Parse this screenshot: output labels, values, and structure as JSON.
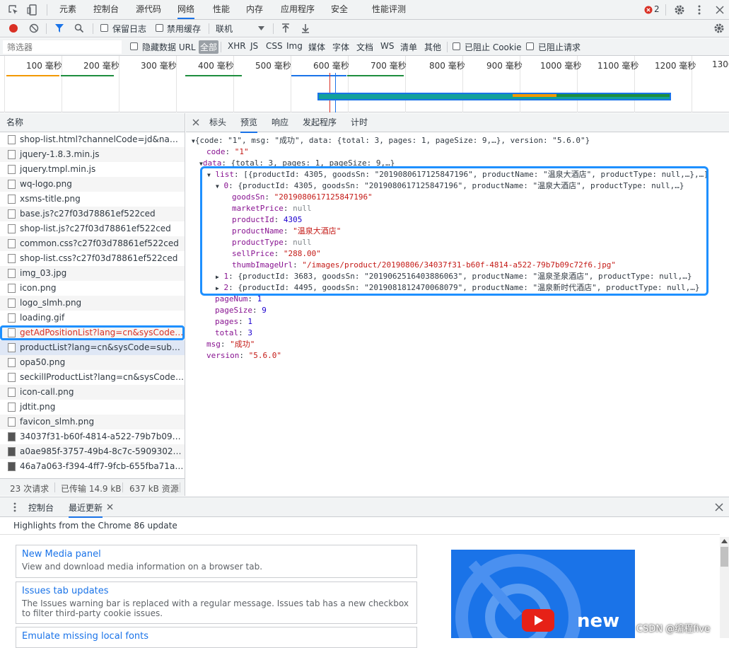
{
  "top_tabs": [
    "元素",
    "控制台",
    "源代码",
    "网络",
    "性能",
    "内存",
    "应用程序",
    "安全",
    "性能评测"
  ],
  "active_tab": "网络",
  "error_count": "2",
  "toolbar": {
    "preserve_log": "保留日志",
    "disable_cache": "禁用缓存",
    "throttle": "联机"
  },
  "filter": {
    "placeholder": "筛选器",
    "hide_data_url": "隐藏数据 URL",
    "types": [
      "全部",
      "XHR",
      "JS",
      "CSS",
      "Img",
      "媒体",
      "字体",
      "文档",
      "WS",
      "清单",
      "其他"
    ],
    "blocked_cookie": "已阻止 Cookie",
    "blocked_requests": "已阻止请求"
  },
  "timeline": {
    "ticks": [
      "100 毫秒",
      "200 毫秒",
      "300 毫秒",
      "400 毫秒",
      "500 毫秒",
      "600 毫秒",
      "700 毫秒",
      "800 毫秒",
      "900 毫秒",
      "1000 毫秒",
      "1100 毫秒",
      "1200 毫秒",
      "1300"
    ]
  },
  "requests": {
    "header": "名称",
    "items": [
      "shop-list.html?channelCode=jd&name=...",
      "jquery-1.8.3.min.js",
      "jquery.tmpl.min.js",
      "wq-logo.png",
      "xsms-title.png",
      "base.js?c27f03d78861ef522ced",
      "shop-list.js?c27f03d78861ef522ced",
      "common.css?c27f03d78861ef522ced",
      "shop-list.css?c27f03d78861ef522ced",
      "img_03.jpg",
      "icon.png",
      "logo_slmh.png",
      "loading.gif",
      "getAdPositionList?lang=cn&sysCode=su...",
      "productList?lang=cn&sysCode=sub7415...",
      "opa50.png",
      "seckillProductList?lang=cn&sysCode=sub...",
      "icon-call.png",
      "jdtit.png",
      "favicon_slmh.png",
      "34037f31-b60f-4814-a522-79b7b09c72f6...",
      "a0ae985f-3757-49b4-8c7c-590930265b0...",
      "46a7a063-f394-4ff7-9fcb-655fba71a937.j..."
    ],
    "status": {
      "count": "23 次请求",
      "transferred": "已传输 14.9 kB",
      "resources": "637 kB 资源"
    }
  },
  "detail_tabs": [
    "标头",
    "预览",
    "响应",
    "发起程序",
    "计时"
  ],
  "active_detail_tab": "预览",
  "preview": {
    "root": "{code: \"1\", msg: \"成功\", data: {total: 3, pages: 1, pageSize: 9,…}, version: \"5.6.0\"}",
    "code": "\"1\"",
    "data_summary": "{total: 3, pages: 1, pageSize: 9,…}",
    "list_summary": "[{productId: 4305, goodsSn: \"2019080617125847196\", productName: \"温泉大酒店\", productType: null,…},…]",
    "item0_summary": "{productId: 4305, goodsSn: \"2019080617125847196\", productName: \"温泉大酒店\", productType: null,…}",
    "goodsSn": "\"2019080617125847196\"",
    "marketPrice": "null",
    "productId": "4305",
    "productName": "\"温泉大酒店\"",
    "productType": "null",
    "sellPrice": "\"288.00\"",
    "thumbImageUrl": "\"/images/product/20190806/34037f31-b60f-4814-a522-79b7b09c72f6.jpg\"",
    "item1_summary": "{productId: 3683, goodsSn: \"2019062516403886063\", productName: \"温泉圣泉酒店\", productType: null,…}",
    "item2_summary": "{productId: 4495, goodsSn: \"2019081812470068079\", productName: \"温泉新时代酒店\", productType: null,…}",
    "pageNum": "1",
    "pageSize": "9",
    "pages": "1",
    "total": "3",
    "msg": "\"成功\"",
    "version": "\"5.6.0\""
  },
  "drawer": {
    "tabs": [
      "控制台",
      "最近更新"
    ],
    "active": "最近更新",
    "headline": "Highlights from the Chrome 86 update",
    "cards": [
      {
        "title": "New Media panel",
        "desc": "View and download media information on a browser tab."
      },
      {
        "title": "Issues tab updates",
        "desc": "The Issues warning bar is replaced with a regular message. Issues tab has a new checkbox to filter third-party cookie issues."
      },
      {
        "title": "Emulate missing local fonts",
        "desc": ""
      }
    ],
    "video_text": "new"
  },
  "watermark": "CSDN @编程five",
  "colors": {
    "accent": "#1a73e8",
    "highlight_box": "#1e90ff",
    "error": "#d93025",
    "record": "#d93025"
  }
}
